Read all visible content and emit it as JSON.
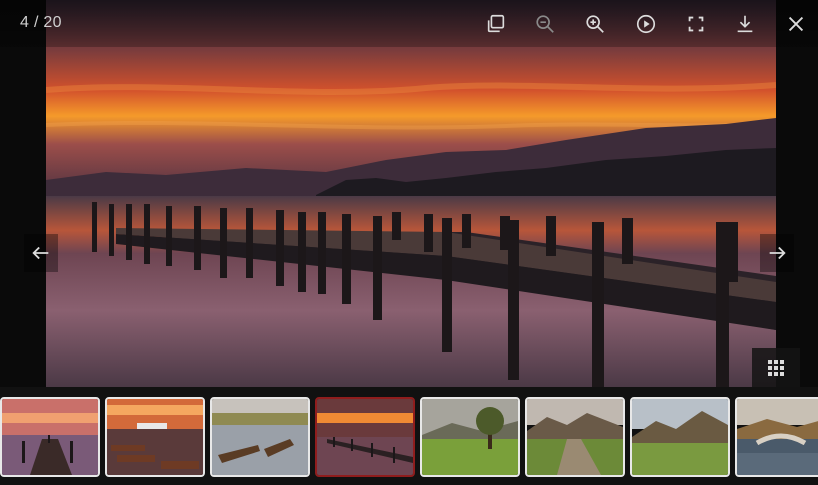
{
  "viewer": {
    "counter": "4 / 20",
    "current_index": 4,
    "total": 20
  },
  "toolbar": {
    "icons": [
      "gallery-actual-size-icon",
      "zoom-out-icon",
      "zoom-in-icon",
      "play-slideshow-icon",
      "fullscreen-icon",
      "download-icon",
      "close-icon"
    ]
  },
  "navigation": {
    "prev_icon": "arrow-left-icon",
    "next_icon": "arrow-right-icon",
    "thumbnail_toggle_icon": "grid-icon"
  },
  "thumbnails": [
    {
      "scene": "jetty-sunset-pink"
    },
    {
      "scene": "boats-harbour-sunset"
    },
    {
      "scene": "rowing-boats-lake"
    },
    {
      "scene": "jetty-sunset-orange",
      "active": true
    },
    {
      "scene": "tree-valley"
    },
    {
      "scene": "country-lane-mountains"
    },
    {
      "scene": "valley-fells"
    },
    {
      "scene": "river-bridge"
    }
  ],
  "colors": {
    "active_thumb_border": "#8f1d1d",
    "thumb_border": "#e8e8e8",
    "icon": "#dcdcdc"
  }
}
